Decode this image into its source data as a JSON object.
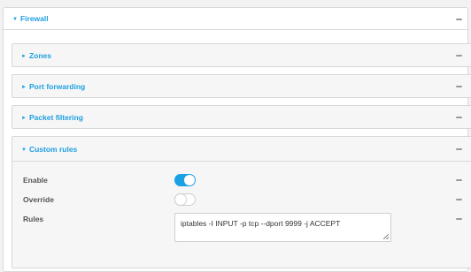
{
  "firewall": {
    "title": "Firewall",
    "panels": [
      {
        "label": "Zones"
      },
      {
        "label": "Port forwarding"
      },
      {
        "label": "Packet filtering"
      }
    ],
    "custom_rules": {
      "title": "Custom rules",
      "enable_label": "Enable",
      "enable_value": true,
      "override_label": "Override",
      "override_value": false,
      "rules_label": "Rules",
      "rules_value": "iptables -I INPUT -p tcp --dport 9999 -j ACCEPT"
    }
  },
  "colors": {
    "accent": "#1e9fe2",
    "toggle_on": "#1aa0e4",
    "background": "#f2f2f2"
  },
  "icons": {
    "expanded": "triangle-down-icon",
    "collapsed": "triangle-right-icon",
    "menu": "dash-menu-icon"
  }
}
